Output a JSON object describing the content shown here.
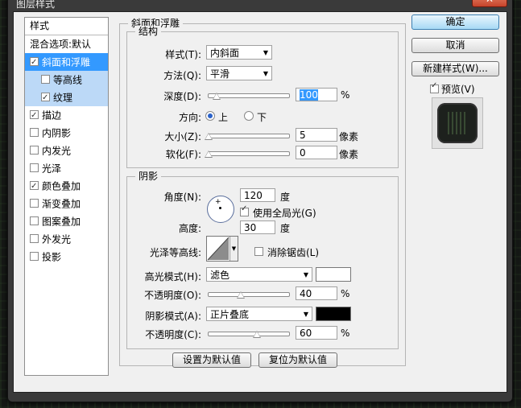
{
  "window": {
    "title": "图层样式",
    "close_glyph": "✕"
  },
  "style_list": {
    "header": "样式",
    "blend_options": "混合选项:默认",
    "items": [
      {
        "label": "斜面和浮雕",
        "checked": true
      },
      {
        "label": "等高线",
        "checked": false
      },
      {
        "label": "纹理",
        "checked": true
      },
      {
        "label": "描边",
        "checked": true
      },
      {
        "label": "内阴影",
        "checked": false
      },
      {
        "label": "内发光",
        "checked": false
      },
      {
        "label": "光泽",
        "checked": false
      },
      {
        "label": "颜色叠加",
        "checked": true
      },
      {
        "label": "渐变叠加",
        "checked": false
      },
      {
        "label": "图案叠加",
        "checked": false
      },
      {
        "label": "外发光",
        "checked": false
      },
      {
        "label": "投影",
        "checked": false
      }
    ]
  },
  "bevel": {
    "group_title": "斜面和浮雕",
    "structure": {
      "title": "结构",
      "style_label": "样式(T):",
      "style_value": "内斜面",
      "technique_label": "方法(Q):",
      "technique_value": "平滑",
      "depth_label": "深度(D):",
      "depth_value": "100",
      "depth_unit": "%",
      "depth_level": 0.1,
      "direction_label": "方向:",
      "direction_up": "上",
      "direction_down": "下",
      "size_label": "大小(Z):",
      "size_value": "5",
      "size_unit": "像素",
      "size_level": 0.0,
      "soften_label": "软化(F):",
      "soften_value": "0",
      "soften_unit": "像素",
      "soften_level": 0.0
    },
    "shading": {
      "title": "阴影",
      "angle_label": "角度(N):",
      "angle_value": "120",
      "angle_unit": "度",
      "global_light_label": "使用全局光(G)",
      "global_light_checked": true,
      "altitude_label": "高度:",
      "altitude_value": "30",
      "altitude_unit": "度",
      "gloss_label": "光泽等高线:",
      "antialias_label": "消除锯齿(L)",
      "antialias_checked": false,
      "highlight_mode_label": "高光模式(H):",
      "highlight_mode_value": "滤色",
      "highlight_color": "#ffffff",
      "highlight_opacity_label": "不透明度(O):",
      "highlight_opacity_value": "40",
      "highlight_opacity_unit": "%",
      "highlight_opacity_level": 0.4,
      "shadow_mode_label": "阴影模式(A):",
      "shadow_mode_value": "正片叠底",
      "shadow_color": "#000000",
      "shadow_opacity_label": "不透明度(C):",
      "shadow_opacity_value": "60",
      "shadow_opacity_unit": "%",
      "shadow_opacity_level": 0.6
    },
    "make_default": "设置为默认值",
    "reset_default": "复位为默认值"
  },
  "right_panel": {
    "ok": "确定",
    "cancel": "取消",
    "new_style": "新建样式(W)...",
    "preview_label": "预览(V)",
    "preview_checked": true
  }
}
